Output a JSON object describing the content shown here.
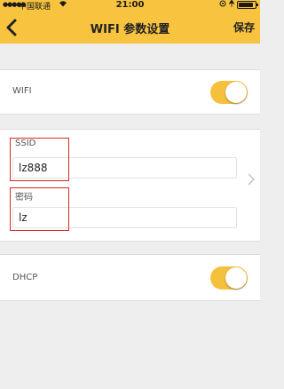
{
  "status_bar": {
    "carrier": "中国联通",
    "time": "21:00",
    "battery_level": 0.9,
    "icons": [
      "signal-dots-icon",
      "wifi-icon",
      "location-icon",
      "alarm-icon",
      "battery-icon"
    ]
  },
  "nav": {
    "back_icon": "chevron-left-icon",
    "title": "WIFI 参数设置",
    "save_label": "保存"
  },
  "wifi_row": {
    "label": "WIFI",
    "enabled": true
  },
  "credentials": {
    "ssid_label": "SSID",
    "ssid_value": "lz888",
    "password_label": "密码",
    "password_value": "lz"
  },
  "dhcp_row": {
    "label": "DHCP",
    "enabled": true
  },
  "colors": {
    "accent": "#f8c440",
    "toggle_on": "#f5c13d",
    "highlight_box": "#d42a2a",
    "background": "#eeeeef"
  }
}
